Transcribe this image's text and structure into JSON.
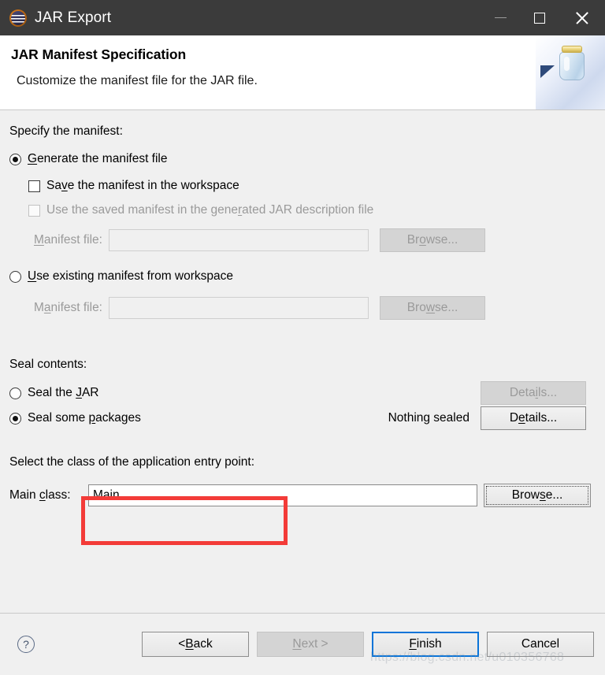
{
  "window": {
    "title": "JAR Export",
    "app_icon": "eclipse-icon",
    "controls": {
      "minimize": "minimize-icon",
      "maximize": "maximize-icon",
      "close": "close-icon"
    }
  },
  "header": {
    "title": "JAR Manifest Specification",
    "subtitle": "Customize the manifest file for the JAR file.",
    "art_icon": "jar-export-banner-icon"
  },
  "manifest_section": {
    "group_label": "Specify the manifest:",
    "generate_radio": {
      "pre": "",
      "mnemonic": "G",
      "post": "enerate the manifest file",
      "selected": true
    },
    "save_checkbox": {
      "pre": "Sa",
      "mnemonic": "v",
      "post": "e the manifest in the workspace",
      "checked": false
    },
    "use_saved_checkbox": {
      "pre": "Use the saved manifest in the gene",
      "mnemonic": "r",
      "post": "ated JAR description file",
      "checked": false,
      "disabled": true
    },
    "file_row_1": {
      "label_pre": "",
      "label_mnemonic": "M",
      "label_post": "anifest file:",
      "value": "",
      "placeholder": "",
      "browse_pre": "Br",
      "browse_mnemonic": "o",
      "browse_post": "wse...",
      "disabled": true
    },
    "use_existing_radio": {
      "pre": "",
      "mnemonic": "U",
      "post": "se existing manifest from workspace",
      "selected": false
    },
    "file_row_2": {
      "label_pre": "M",
      "label_mnemonic": "a",
      "label_post": "nifest file:",
      "value": "",
      "placeholder": "",
      "browse_pre": "Bro",
      "browse_mnemonic": "w",
      "browse_post": "se...",
      "disabled": true
    }
  },
  "seal_section": {
    "group_label": "Seal contents:",
    "seal_jar_radio": {
      "pre": "Seal the ",
      "mnemonic": "J",
      "post": "AR",
      "selected": false
    },
    "seal_jar_details": {
      "pre": "Deta",
      "mnemonic": "i",
      "post": "ls...",
      "disabled": true
    },
    "seal_packages_radio": {
      "pre": "Seal some ",
      "mnemonic": "p",
      "post": "ackages",
      "selected": true
    },
    "status_text": "Nothing sealed",
    "seal_packages_details": {
      "pre": "D",
      "mnemonic": "e",
      "post": "tails...",
      "disabled": false
    }
  },
  "entry_point_section": {
    "group_label": "Select the class of the application entry point:",
    "main_class_label": {
      "pre": "Main ",
      "mnemonic": "c",
      "post": "lass:"
    },
    "main_class_value": "Main",
    "main_class_placeholder": "",
    "browse": {
      "pre": "Brow",
      "mnemonic": "s",
      "post": "e..."
    },
    "highlight_color": "#f33b38"
  },
  "footer": {
    "help_icon": "help-icon",
    "help_glyph": "?",
    "back": {
      "pre": "< ",
      "mnemonic": "B",
      "post": "ack",
      "disabled": false
    },
    "next": {
      "pre": "",
      "mnemonic": "N",
      "post": "ext >",
      "disabled": true
    },
    "finish": {
      "pre": "",
      "mnemonic": "F",
      "post": "inish",
      "default": true
    },
    "cancel": {
      "pre": "Cancel",
      "mnemonic": "",
      "post": "",
      "disabled": false
    }
  },
  "watermark": "https://blog.csdn.net/u010356768"
}
